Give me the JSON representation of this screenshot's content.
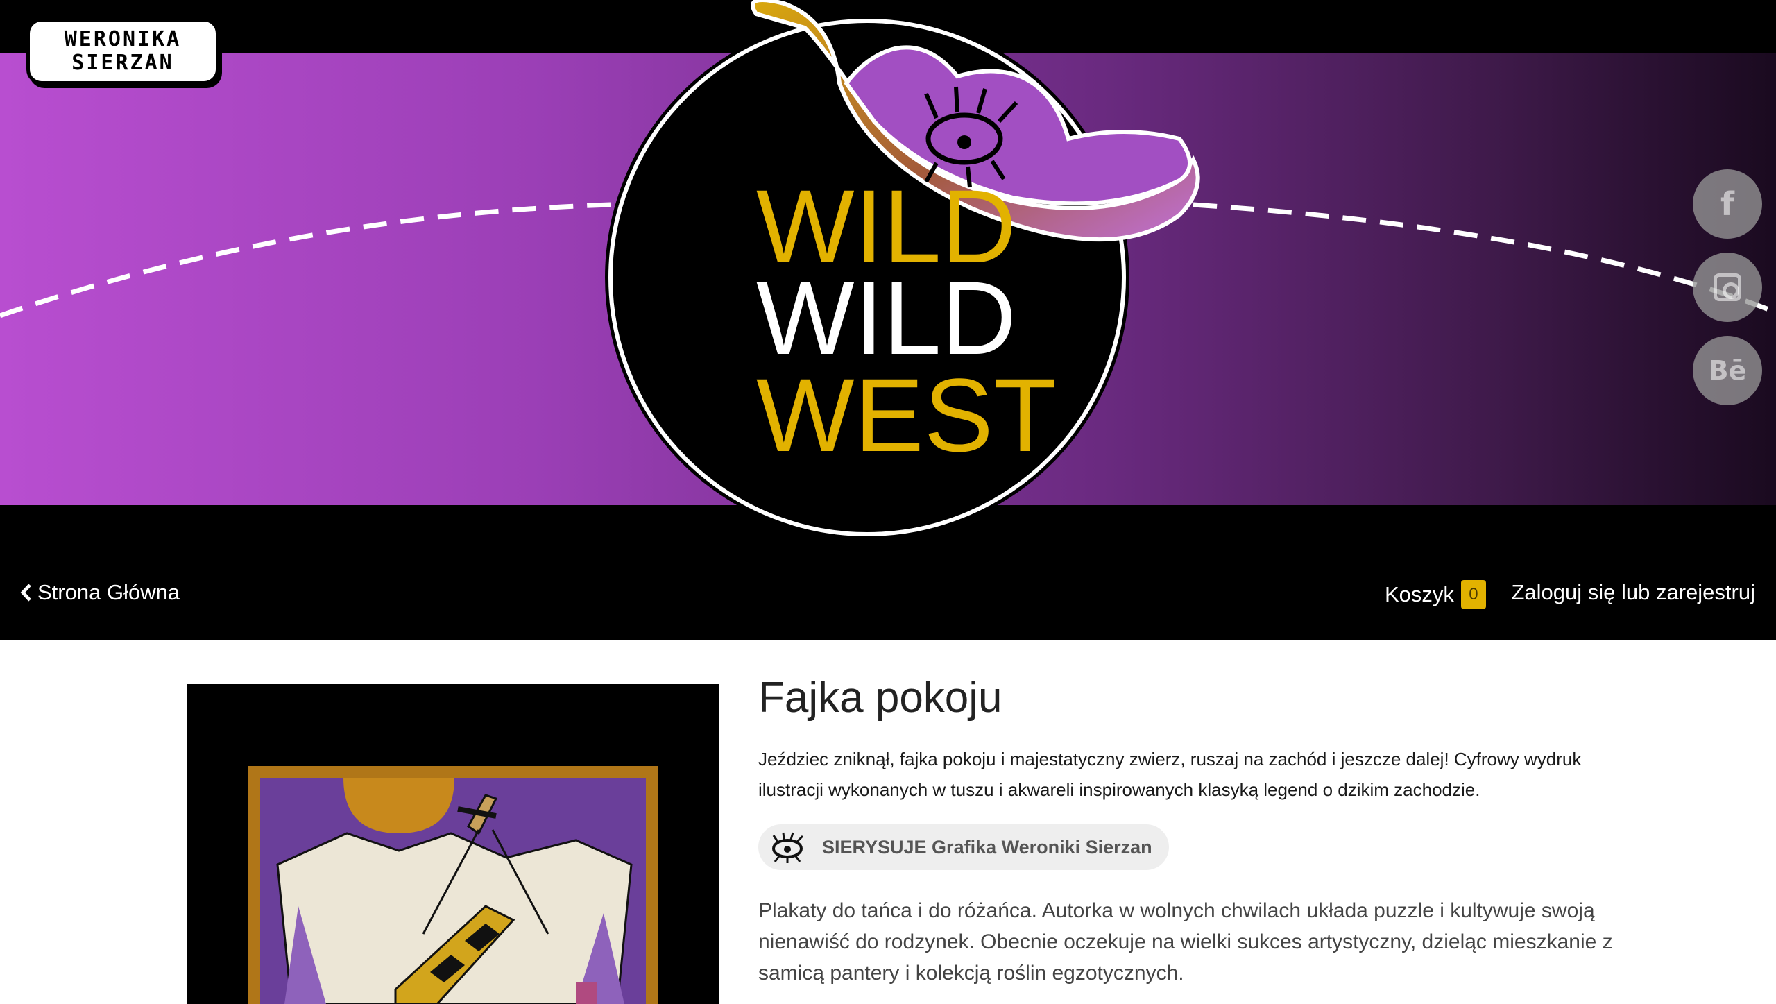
{
  "brand": {
    "logo_line1": "WERONIKA",
    "logo_line2": "SIERZAN"
  },
  "hero": {
    "title_line1": "WILD",
    "title_line2": "WILD",
    "title_line3": "WEST",
    "colors": {
      "purple": "#b04ac8",
      "gold": "#e2b200",
      "black": "#000000"
    }
  },
  "social": [
    {
      "name": "facebook",
      "icon": "facebook-icon",
      "glyph": "f"
    },
    {
      "name": "instagram",
      "icon": "instagram-icon"
    },
    {
      "name": "behance",
      "icon": "behance-icon",
      "glyph": "Bē"
    }
  ],
  "nav": {
    "back_label": "Strona Główna",
    "cart_label": "Koszyk",
    "cart_count": "0",
    "login_label": "Zaloguj się lub zarejestruj"
  },
  "product": {
    "title": "Fajka pokoju",
    "description": "Jeździec zniknął, fajka pokoju i majestatyczny zwierz, ruszaj na zachód i jeszcze dalej! Cyfrowy wydruk ilustracji wykonanych w tuszu i akwareli inspirowanych klasyką legend o dzikim zachodzie.",
    "seller": "SIERYSUJE Grafika Weroniki Sierzan",
    "bio": "Plakaty do tańca i do różańca. Autorka w wolnych chwilach układa puzzle i kultywuje swoją nienawiść do rodzynek. Obecnie oczekuje na wielki sukces artystyczny, dzieląc mieszkanie z samicą pantery i kolekcją roślin egzotycznych."
  },
  "accent_color": "#e2b200"
}
